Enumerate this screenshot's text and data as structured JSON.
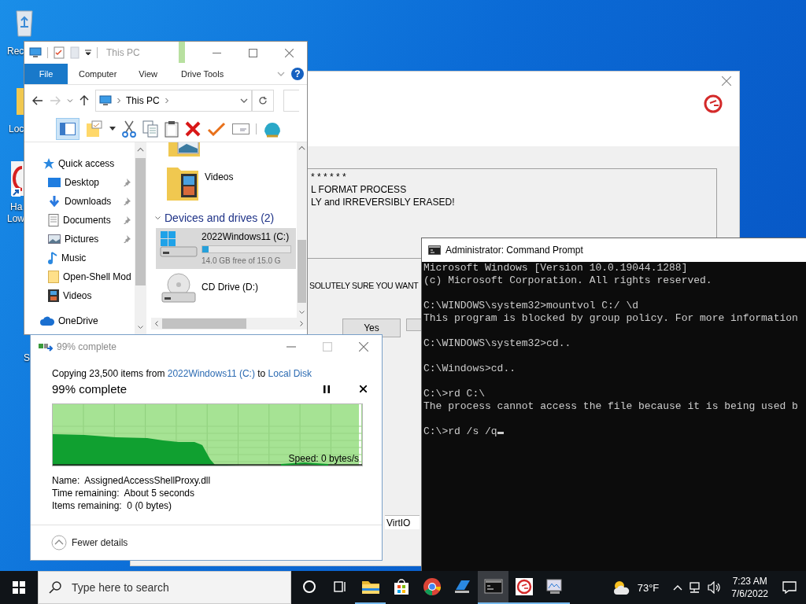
{
  "desktop": {
    "icons": [
      {
        "lines": [
          "Rec"
        ]
      },
      {
        "lines": [
          "Loc"
        ]
      },
      {
        "lines": [
          "Ha",
          "Low"
        ]
      },
      {
        "lines": [
          "S"
        ]
      }
    ]
  },
  "format_dialog": {
    "log_lines": [
      "* * * * * *",
      "L FORMAT PROCESS",
      "LY and IRREVERSIBLY ERASED!"
    ],
    "question": "SOLUTELY SURE YOU WANT",
    "buttons": [
      "Yes"
    ],
    "list_cell": "VirtIO"
  },
  "explorer": {
    "title": "This PC",
    "help": "?",
    "tabs": [
      {
        "label": "File",
        "kind": "file"
      },
      {
        "label": "Computer",
        "kind": "plain"
      },
      {
        "label": "View",
        "kind": "plain"
      },
      {
        "label": "Drive Tools",
        "kind": "contextual"
      }
    ],
    "forward_disabled": true,
    "address": "This PC",
    "navigation_pane_on": true,
    "nav_items": [
      {
        "label": "Quick access",
        "pinned": false,
        "children": [
          {
            "label": "Desktop",
            "pinned": true
          },
          {
            "label": "Downloads",
            "pinned": true
          },
          {
            "label": "Documents",
            "pinned": true
          },
          {
            "label": "Pictures",
            "pinned": true
          },
          {
            "label": "Music",
            "pinned": false
          },
          {
            "label": "Open-Shell Mod",
            "pinned": false
          },
          {
            "label": "Videos",
            "pinned": false
          }
        ]
      },
      {
        "label": "OneDrive",
        "pinned": false
      }
    ],
    "folders": [
      {
        "label": "Videos"
      }
    ],
    "section": {
      "label": "Devices and drives (2)",
      "expanded": true
    },
    "drives": [
      {
        "label": "2022Windows11 (C:)",
        "selected": true,
        "level": 0.07,
        "space": "14.0 GB free of 15.0 G"
      },
      {
        "label": "CD Drive (D:)",
        "selected": false
      }
    ]
  },
  "copy_dialog": {
    "title": "99% complete",
    "summary": [
      {
        "kind": "text",
        "text": "Copying 23,500 items from "
      },
      {
        "kind": "link",
        "text": "2022Windows11 (C:)"
      },
      {
        "kind": "text",
        "text": " to "
      },
      {
        "kind": "link",
        "text": "Local Disk"
      }
    ],
    "status": "99% complete",
    "level": 0.99,
    "speed": "Speed: 0 bytes/s",
    "details": [
      "Name:  AssignedAccessShellProxy.dll",
      "Time remaining:  About 5 seconds",
      "Items remaining:  0 (0 bytes)"
    ],
    "toggle": "Fewer details"
  },
  "command_prompt": {
    "title": "Administrator: Command Prompt",
    "cursor": true,
    "blocks": [
      [
        "Microsoft Windows [Version 10.0.19044.1288]",
        "(c) Microsoft Corporation. All rights reserved."
      ],
      [
        "C:\\WINDOWS\\system32>mountvol C:/ \\d",
        "This program is blocked by group policy. For more information"
      ],
      [
        "C:\\WINDOWS\\system32>cd.."
      ],
      [
        "C:\\Windows>cd.."
      ],
      [
        "C:\\>rd C:\\",
        "The process cannot access the file because it is being used b"
      ],
      [
        "C:\\>rd /s /q"
      ]
    ]
  },
  "taskbar": {
    "search_placeholder": "Type here to search",
    "apps": [
      {
        "running": true,
        "selected": false
      },
      {
        "running": false,
        "selected": false
      },
      {
        "running": false,
        "selected": false
      },
      {
        "running": false,
        "selected": false
      },
      {
        "running": true,
        "selected": true
      },
      {
        "running": true,
        "selected": false
      },
      {
        "running": true,
        "selected": false
      }
    ],
    "weather": "73°F",
    "time": "7:23 AM",
    "date": "7/6/2022"
  }
}
